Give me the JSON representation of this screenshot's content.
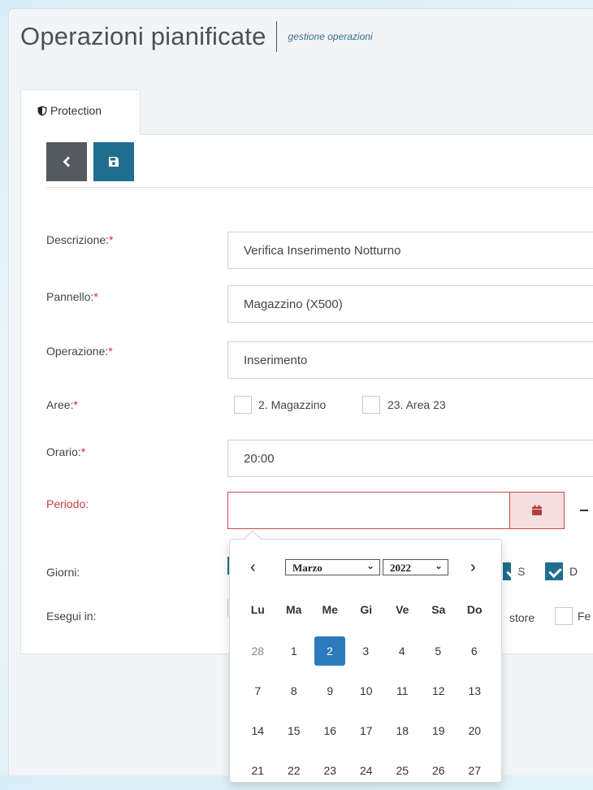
{
  "header": {
    "title": "Operazioni pianificate",
    "subtitle": "gestione operazioni"
  },
  "tab": {
    "label": "Protection",
    "icon": "shield-icon"
  },
  "toolbar": {
    "back_icon": "chevron-left-icon",
    "save_icon": "floppy-icon"
  },
  "form": {
    "descrizione": {
      "label": "Descrizione:",
      "required": "*",
      "value": "Verifica Inserimento Notturno"
    },
    "pannello": {
      "label": "Pannello:",
      "required": "*",
      "value": "Magazzino (X500)"
    },
    "operazione": {
      "label": "Operazione:",
      "required": "*",
      "value": "Inserimento"
    },
    "aree": {
      "label": "Aree:",
      "required": "*",
      "options": [
        {
          "label": "2. Magazzino",
          "checked": false
        },
        {
          "label": "23. Area 23",
          "checked": false
        }
      ]
    },
    "orario": {
      "label": "Orario:",
      "required": "*",
      "value": "20:00"
    },
    "periodo": {
      "label": "Periodo:",
      "value": ""
    },
    "giorni": {
      "label": "Giorni:",
      "visible_options": [
        {
          "label": "S",
          "checked": true
        },
        {
          "label": "D",
          "checked": true
        }
      ]
    },
    "esegui": {
      "label": "Esegui in:",
      "visible_options": [
        {
          "label": "store",
          "checked": false
        },
        {
          "label": "Fe",
          "checked": false
        }
      ]
    }
  },
  "datepicker": {
    "month": "Marzo",
    "year": "2022",
    "prev": "‹",
    "next": "›",
    "weekdays": [
      "Lu",
      "Ma",
      "Me",
      "Gi",
      "Ve",
      "Sa",
      "Do"
    ],
    "weeks": [
      [
        "28",
        "1",
        "2",
        "3",
        "4",
        "5",
        "6"
      ],
      [
        "7",
        "8",
        "9",
        "10",
        "11",
        "12",
        "13"
      ],
      [
        "14",
        "15",
        "16",
        "17",
        "18",
        "19",
        "20"
      ],
      [
        "21",
        "22",
        "23",
        "24",
        "25",
        "26",
        "27"
      ]
    ],
    "selected_day": "2",
    "colors": {
      "selected": "#2b7bbd"
    }
  },
  "colors": {
    "primary": "#1f6e8f",
    "error": "#c94a4a",
    "back_button": "#555a5e"
  }
}
